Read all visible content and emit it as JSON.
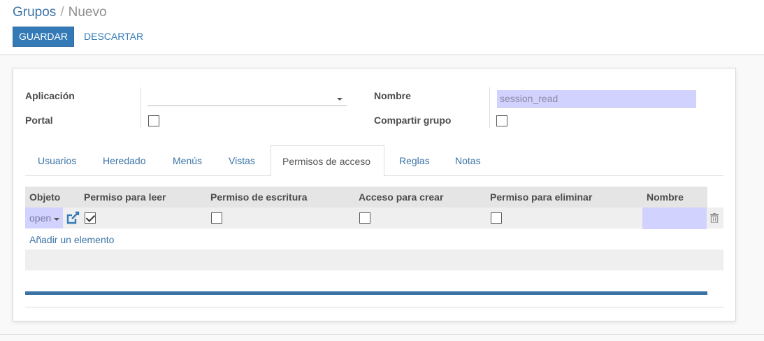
{
  "breadcrumb": {
    "parent": "Grupos",
    "separator": "/",
    "current": "Nuevo"
  },
  "buttons": {
    "save": "GUARDAR",
    "discard": "DESCARTAR"
  },
  "form": {
    "application_label": "Aplicación",
    "application_value": "",
    "portal_label": "Portal",
    "portal_checked": false,
    "name_label": "Nombre",
    "name_value": "session_read",
    "share_label": "Compartir grupo",
    "share_checked": false
  },
  "tabs": [
    {
      "label": "Usuarios",
      "active": false
    },
    {
      "label": "Heredado",
      "active": false
    },
    {
      "label": "Menús",
      "active": false
    },
    {
      "label": "Vistas",
      "active": false
    },
    {
      "label": "Permisos de acceso",
      "active": true
    },
    {
      "label": "Reglas",
      "active": false
    },
    {
      "label": "Notas",
      "active": false
    }
  ],
  "table": {
    "headers": [
      "Objeto",
      "Permiso para leer",
      "Permiso de escritura",
      "Acceso para crear",
      "Permiso para eliminar",
      "Nombre"
    ],
    "rows": [
      {
        "object": "open",
        "read": true,
        "write": false,
        "create": false,
        "unlink": false,
        "name": ""
      }
    ],
    "add_line": "Añadir un elemento"
  },
  "icons": {
    "external_link": "external-link-icon",
    "delete": "trash-icon"
  },
  "colors": {
    "primary": "#337ab7",
    "link": "#3c73a7",
    "required_field": "#d2d2ff"
  }
}
